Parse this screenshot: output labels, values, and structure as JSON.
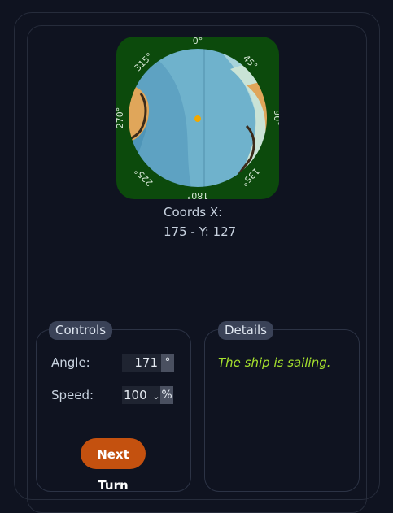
{
  "map": {
    "compass_labels": [
      "0°",
      "45°",
      "90°",
      "135°",
      "180°",
      "225°",
      "270°",
      "315°"
    ],
    "colors": {
      "frame": "#0c4a0c",
      "deep_water": "#5aa0c0",
      "shallow_water": "#8fc6d6",
      "land": "#e0a65a",
      "ship": "#f2a900"
    }
  },
  "coords": {
    "line1": "Coords X:",
    "line2": "175 - Y: 127"
  },
  "controls": {
    "legend": "Controls",
    "angle_label": "Angle:",
    "angle_value": "171",
    "angle_unit": "°",
    "speed_label": "Speed:",
    "speed_value": "100",
    "speed_unit": "%",
    "next_turn": "Next Turn"
  },
  "details": {
    "legend": "Details",
    "status": "The ship is sailing."
  },
  "theme": {
    "background": "#0f1320",
    "accent": "#c4510f",
    "status_color": "#a6e22e"
  }
}
